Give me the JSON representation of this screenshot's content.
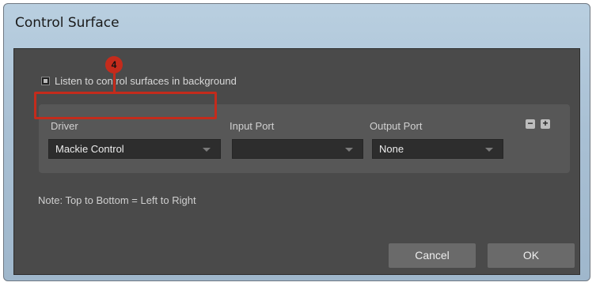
{
  "window": {
    "title": "Control Surface"
  },
  "options": {
    "listen_label": "Listen to control surfaces in background",
    "listen_checked": true
  },
  "columns": {
    "driver": {
      "label": "Driver",
      "value": "Mackie Control"
    },
    "input_port": {
      "label": "Input Port",
      "value": ""
    },
    "output_port": {
      "label": "Output Port",
      "value": "None"
    }
  },
  "row_buttons": {
    "remove": "−",
    "add": "+"
  },
  "annotation": {
    "number": "4",
    "color": "#c42b1c"
  },
  "note": "Note: Top to Bottom = Left to Right",
  "footer": {
    "cancel_label": "Cancel",
    "ok_label": "OK"
  }
}
